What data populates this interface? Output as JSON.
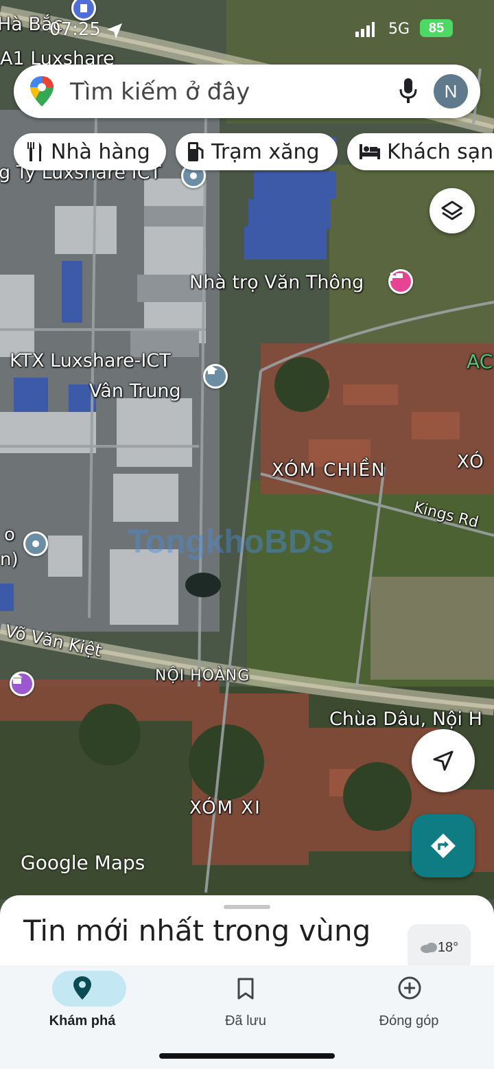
{
  "status_bar": {
    "time": "07:25",
    "network": "5G",
    "battery": "85"
  },
  "search": {
    "placeholder": "Tìm kiếm ở đây",
    "avatar_initial": "N"
  },
  "chips": [
    {
      "label": "Nhà hàng",
      "icon": "restaurant-icon"
    },
    {
      "label": "Trạm xăng",
      "icon": "gas-station-icon"
    },
    {
      "label": "Khách sạn",
      "icon": "hotel-icon"
    }
  ],
  "map": {
    "labels": {
      "top_left_1": "Hà Bắc",
      "top_left_2": "A1 Luxshare",
      "company": "g Ty Luxshare ICT",
      "motel": "Nhà trọ Văn Thông",
      "dorm_1": "KTX Luxshare-ICT",
      "dorm_2": "Vân Trung",
      "hamlet_chien": "XÓM CHIỀN",
      "hamlet_right": "XÓ",
      "kings_rd": "Kings Rd",
      "edge_ac": "AC",
      "road_vvk": "Võ Văn Kiệt",
      "noi_hoang": "NỘI HOÀNG",
      "pagoda": "Chùa Dâu, Nội H",
      "xom_xi": "XÓM XI",
      "left_edge_1": "o",
      "left_edge_2": "n)",
      "watermark_a": "Tongkho",
      "watermark_b": "BDS"
    },
    "attribution": "Google Maps"
  },
  "sheet": {
    "title": "Tin mới nhất trong vùng",
    "weather": "18°"
  },
  "bottom_nav": [
    {
      "label": "Khám phá",
      "icon": "explore-pin-icon",
      "active": true
    },
    {
      "label": "Đã lưu",
      "icon": "bookmark-icon",
      "active": false
    },
    {
      "label": "Đóng góp",
      "icon": "add-circle-icon",
      "active": false
    }
  ],
  "colors": {
    "accent": "#0f7c84",
    "active_pill": "#c3e7f3",
    "hotel_pin": "#e84393",
    "school_pin": "#5d8aa8"
  }
}
